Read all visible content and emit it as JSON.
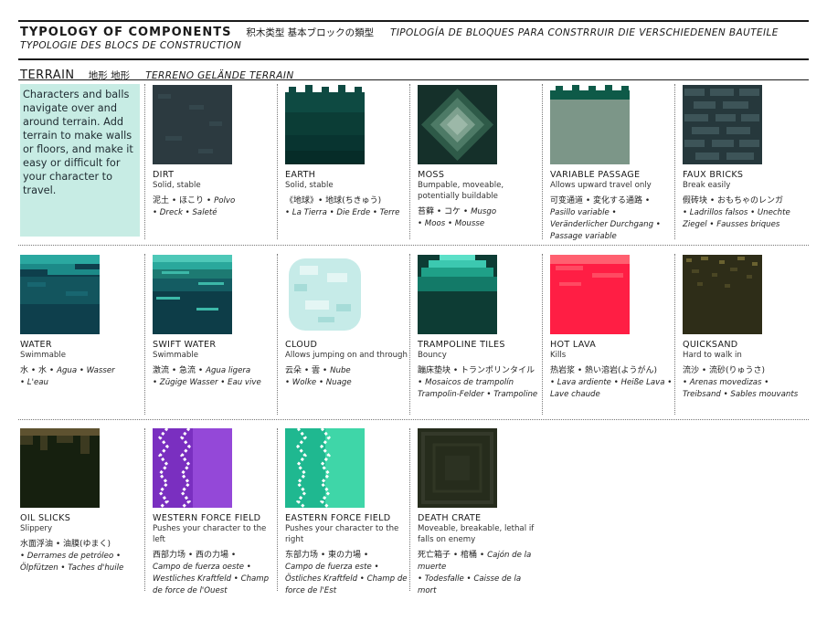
{
  "header": {
    "title": "TYPOLOGY OF COMPONENTS",
    "title_jp": "积木类型   基本ブロックの類型",
    "title_es_de": "TIPOLOGÍA DE BLOQUES PARA CONSTRRUIR   DIE VERSCHIEDENEN BAUTEILE",
    "subtitle_fr": "TYPOLOGIE DES BLOCS DE CONSTRUCTION"
  },
  "section": {
    "title": "TERRAIN",
    "title_jp": "地形  地形",
    "title_other": "TERRENO   GELÄNDE   TERRAIN",
    "intro": "Characters and balls navigate over and around terrain. Add terrain to make walls or floors, and make it easy or difficult for your character to travel."
  },
  "components": [
    {
      "name": "DIRT",
      "desc": "Solid, stable",
      "jp": "泥土 • ほこり • ",
      "it1": "Polvo",
      "line2": "",
      "it2": "• Dreck • Saleté"
    },
    {
      "name": "EARTH",
      "desc": "Solid, stable",
      "jp": "《地球》• 地球(ちきゅう)",
      "it1": "",
      "line2": "",
      "it2": "• La Tierra • Die Erde • Terre"
    },
    {
      "name": "MOSS",
      "desc": "Bumpable, moveable, potentially buildable",
      "jp": "苔藓 • コケ • ",
      "it1": "Musgo",
      "line2": "",
      "it2": "• Moos • Mousse"
    },
    {
      "name": "VARIABLE PASSAGE",
      "desc": "Allows upward travel only",
      "jp": "可变通道 • 変化する通路 •",
      "it1": "",
      "line2": "",
      "it2": "Pasillo variable • Veränderlicher Durchgang • Passage variable"
    },
    {
      "name": "FAUX BRICKS",
      "desc": "Break easily",
      "jp": "假砖块 • おもちゃのレンガ",
      "it1": "",
      "line2": "",
      "it2": "• Ladrillos falsos • Unechte Ziegel • Fausses briques"
    },
    {
      "name": "WATER",
      "desc": "Swimmable",
      "jp": "水 • 水 • ",
      "it1": "Agua • Wasser",
      "line2": "",
      "it2": "• L'eau"
    },
    {
      "name": "SWIFT WATER",
      "desc": "Swimmable",
      "jp": "激流 • 急流 • ",
      "it1": "Agua ligera",
      "line2": "",
      "it2": "• Zügige Wasser • Eau vive"
    },
    {
      "name": "CLOUD",
      "desc": "Allows jumping on and through",
      "jp": "云朵 • 雲 • ",
      "it1": "Nube",
      "line2": "",
      "it2": "• Wolke • Nuage"
    },
    {
      "name": "TRAMPOLINE TILES",
      "desc": "Bouncy",
      "jp": "蹦床垫块 • トランポリンタイル • ",
      "it1": "Mosaicos de trampolín",
      "line2": "",
      "it2": "Trampolin-Felder • Trampoline"
    },
    {
      "name": "HOT LAVA",
      "desc": "Kills",
      "jp": "热岩浆 • 熱い溶岩(ようがん)",
      "it1": "",
      "line2": "",
      "it2": "• Lava ardiente • Heiße Lava • Lave chaude"
    },
    {
      "name": "QUICKSAND",
      "desc": "Hard to walk in",
      "jp": "流沙 • 流砂(りゅうさ)",
      "it1": "",
      "line2": "",
      "it2": "• Arenas movedizas • Treibsand • Sables mouvants"
    },
    {
      "name": "OIL SLICKS",
      "desc": "Slippery",
      "jp": "水面浮油 • 油膜(ゆまく)",
      "it1": "",
      "line2": "",
      "it2": "• Derrames de petróleo • Ölpfützen • Taches d'huile"
    },
    {
      "name": "WESTERN FORCE FIELD",
      "desc": "Pushes your character to the left",
      "jp": "西部力场 • 西の力場 •",
      "it1": "",
      "line2": "",
      "it2": "Campo de fuerza oeste • Westliches Kraftfeld • Champ de force de l'Ouest"
    },
    {
      "name": "EASTERN FORCE FIELD",
      "desc": "Pushes your character to the right",
      "jp": "东部力场 • 東の力場 •",
      "it1": "",
      "line2": "",
      "it2": "Campo de fuerza este • Östliches Kraftfeld • Champ de force de l'Est"
    },
    {
      "name": "DEATH CRATE",
      "desc": "Moveable, breakable, lethal if falls on enemy",
      "jp": "死亡箱子 • 棺桶 • ",
      "it1": "Cajón de la muerte",
      "line2": "",
      "it2": "• Todesfalle • Caisse de la mort"
    }
  ],
  "colors": {
    "intro_bg": "#c7ece4",
    "dirt": "#2c3a40",
    "earth": "#0e4a42",
    "moss": "#2a4a3a",
    "variable": "#7c9688",
    "faux": "#2e4246",
    "water": "#13555e",
    "swift": "#1d7a72",
    "cloud": "#c6ebe8",
    "tramp": "#0d3c34",
    "lava": "#ff1e44",
    "quick": "#2e2d18",
    "oil": "#16200f",
    "west": "#8b3fd0",
    "east": "#3fd6a8",
    "crate": "#262c1c"
  }
}
